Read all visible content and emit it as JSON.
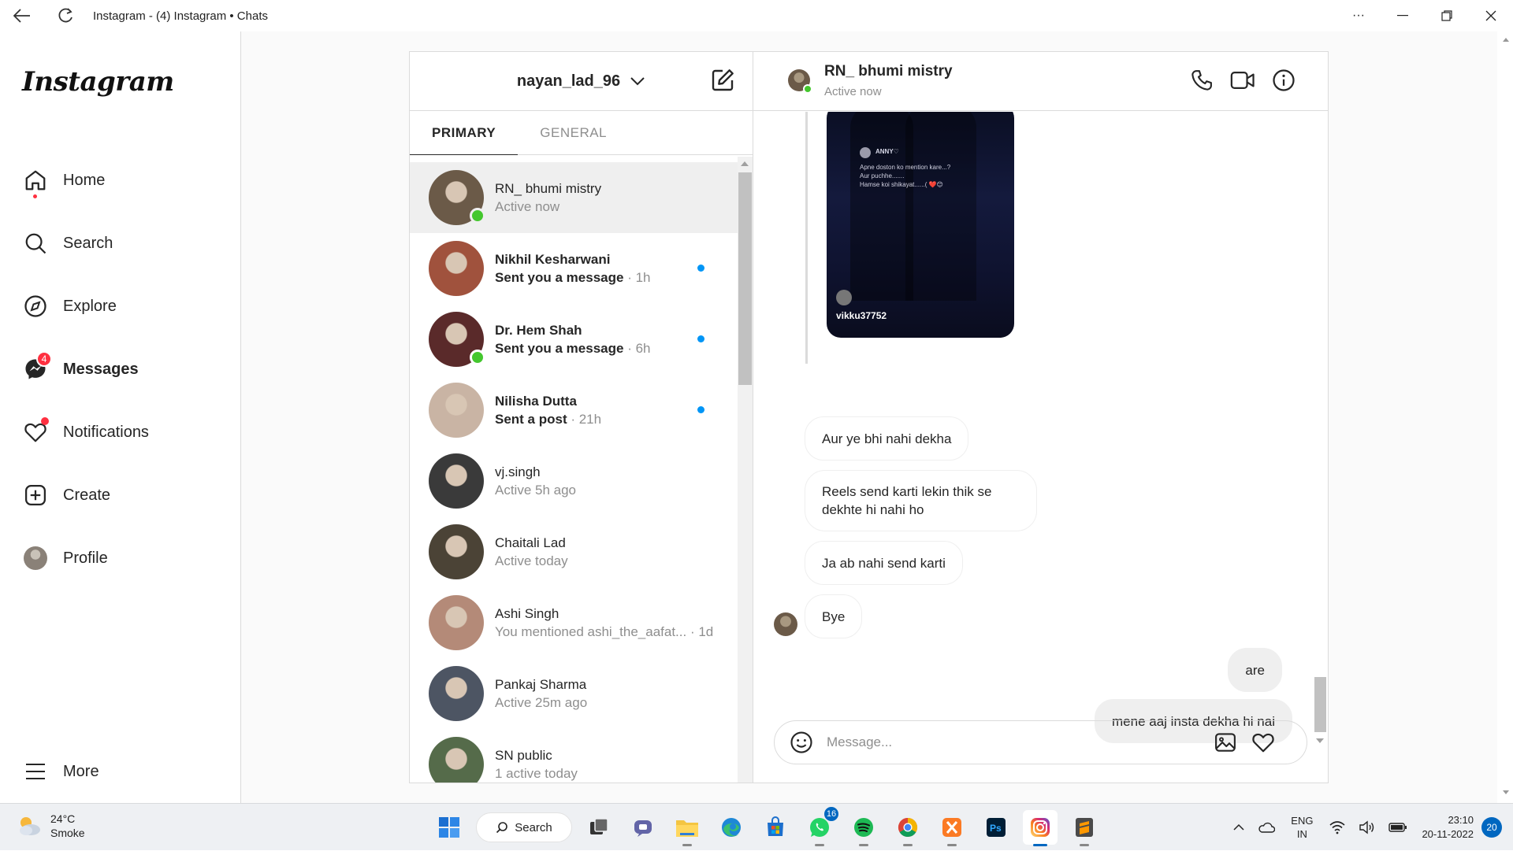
{
  "window": {
    "title": "Instagram - (4) Instagram • Chats"
  },
  "nav": {
    "logo": "Instagram",
    "items": [
      {
        "label": "Home",
        "icon": "home-icon"
      },
      {
        "label": "Search",
        "icon": "search-icon"
      },
      {
        "label": "Explore",
        "icon": "compass-icon"
      },
      {
        "label": "Messages",
        "icon": "messenger-icon",
        "badge": "4"
      },
      {
        "label": "Notifications",
        "icon": "heart-icon"
      },
      {
        "label": "Create",
        "icon": "plus-square-icon"
      },
      {
        "label": "Profile",
        "icon": "profile-avatar"
      }
    ],
    "more": "More"
  },
  "inbox": {
    "account": "nayan_lad_96",
    "tabs": [
      "PRIMARY",
      "GENERAL"
    ],
    "conversations": [
      {
        "name": "RN_ bhumi mistry",
        "sub": "Active now",
        "time": "",
        "online": true,
        "unread": false,
        "selected": true,
        "color": "#6b5a48"
      },
      {
        "name": "Nikhil Kesharwani",
        "sub": "Sent you a message",
        "time": " · 1h",
        "online": false,
        "unread": true,
        "color": "#a0523d"
      },
      {
        "name": "Dr. Hem Shah",
        "sub": "Sent you a message",
        "time": " · 6h",
        "online": true,
        "unread": true,
        "color": "#5a2a2a"
      },
      {
        "name": "Nilisha Dutta",
        "sub": "Sent a post",
        "time": " · 21h",
        "online": false,
        "unread": true,
        "color": "#c9b4a4"
      },
      {
        "name": "vj.singh",
        "sub": "Active 5h ago",
        "time": "",
        "online": false,
        "unread": false,
        "color": "#3a3a3a"
      },
      {
        "name": "Chaitali Lad",
        "sub": "Active today",
        "time": "",
        "online": false,
        "unread": false,
        "color": "#4b4336"
      },
      {
        "name": "Ashi Singh",
        "sub": "You mentioned ashi_the_aafat...",
        "time": " · 1d",
        "online": false,
        "unread": false,
        "color": "#b48a78"
      },
      {
        "name": "Pankaj Sharma",
        "sub": "Active 25m ago",
        "time": "",
        "online": false,
        "unread": false,
        "color": "#4d5563"
      },
      {
        "name": "SN public",
        "sub": "1 active today",
        "time": "",
        "online": false,
        "unread": false,
        "color": "#556b4a"
      }
    ]
  },
  "chat": {
    "name": "RN_ bhumi mistry",
    "status": "Active now",
    "post": {
      "username": "vikku37752",
      "inner_name": "ANNY♡",
      "inner_lines": [
        "Apne doston ko mention kare...?",
        "Aur puchhe.......",
        "Hamse koi shikayat......( ❤️😊"
      ]
    },
    "messages": [
      {
        "text": "Aur ye bhi nahi dekha",
        "mine": false
      },
      {
        "text": "Reels send karti lekin thik se dekhte hi nahi ho",
        "mine": false
      },
      {
        "text": "Ja ab nahi send karti",
        "mine": false
      },
      {
        "text": "Bye",
        "mine": false
      },
      {
        "text": "are",
        "mine": true
      },
      {
        "text": "mene aaj insta dekha hi nai",
        "mine": true
      }
    ],
    "placeholder": "Message..."
  },
  "taskbar": {
    "temp": "24°C",
    "weather": "Smoke",
    "search": "Search",
    "whatsapp_badge": "16",
    "lang1": "ENG",
    "lang2": "IN",
    "time": "23:10",
    "date": "20-11-2022",
    "notifications": "20"
  }
}
